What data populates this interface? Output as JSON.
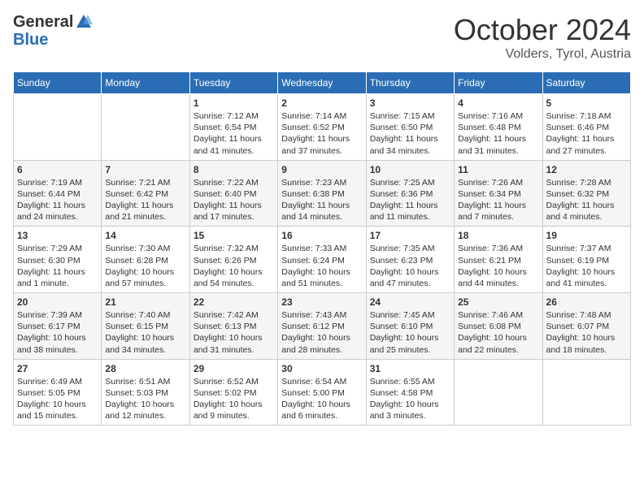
{
  "logo": {
    "general": "General",
    "blue": "Blue"
  },
  "header": {
    "month": "October 2024",
    "location": "Volders, Tyrol, Austria"
  },
  "weekdays": [
    "Sunday",
    "Monday",
    "Tuesday",
    "Wednesday",
    "Thursday",
    "Friday",
    "Saturday"
  ],
  "weeks": [
    [
      {
        "day": "",
        "info": ""
      },
      {
        "day": "",
        "info": ""
      },
      {
        "day": "1",
        "info": "Sunrise: 7:12 AM\nSunset: 6:54 PM\nDaylight: 11 hours and 41 minutes."
      },
      {
        "day": "2",
        "info": "Sunrise: 7:14 AM\nSunset: 6:52 PM\nDaylight: 11 hours and 37 minutes."
      },
      {
        "day": "3",
        "info": "Sunrise: 7:15 AM\nSunset: 6:50 PM\nDaylight: 11 hours and 34 minutes."
      },
      {
        "day": "4",
        "info": "Sunrise: 7:16 AM\nSunset: 6:48 PM\nDaylight: 11 hours and 31 minutes."
      },
      {
        "day": "5",
        "info": "Sunrise: 7:18 AM\nSunset: 6:46 PM\nDaylight: 11 hours and 27 minutes."
      }
    ],
    [
      {
        "day": "6",
        "info": "Sunrise: 7:19 AM\nSunset: 6:44 PM\nDaylight: 11 hours and 24 minutes."
      },
      {
        "day": "7",
        "info": "Sunrise: 7:21 AM\nSunset: 6:42 PM\nDaylight: 11 hours and 21 minutes."
      },
      {
        "day": "8",
        "info": "Sunrise: 7:22 AM\nSunset: 6:40 PM\nDaylight: 11 hours and 17 minutes."
      },
      {
        "day": "9",
        "info": "Sunrise: 7:23 AM\nSunset: 6:38 PM\nDaylight: 11 hours and 14 minutes."
      },
      {
        "day": "10",
        "info": "Sunrise: 7:25 AM\nSunset: 6:36 PM\nDaylight: 11 hours and 11 minutes."
      },
      {
        "day": "11",
        "info": "Sunrise: 7:26 AM\nSunset: 6:34 PM\nDaylight: 11 hours and 7 minutes."
      },
      {
        "day": "12",
        "info": "Sunrise: 7:28 AM\nSunset: 6:32 PM\nDaylight: 11 hours and 4 minutes."
      }
    ],
    [
      {
        "day": "13",
        "info": "Sunrise: 7:29 AM\nSunset: 6:30 PM\nDaylight: 11 hours and 1 minute."
      },
      {
        "day": "14",
        "info": "Sunrise: 7:30 AM\nSunset: 6:28 PM\nDaylight: 10 hours and 57 minutes."
      },
      {
        "day": "15",
        "info": "Sunrise: 7:32 AM\nSunset: 6:26 PM\nDaylight: 10 hours and 54 minutes."
      },
      {
        "day": "16",
        "info": "Sunrise: 7:33 AM\nSunset: 6:24 PM\nDaylight: 10 hours and 51 minutes."
      },
      {
        "day": "17",
        "info": "Sunrise: 7:35 AM\nSunset: 6:23 PM\nDaylight: 10 hours and 47 minutes."
      },
      {
        "day": "18",
        "info": "Sunrise: 7:36 AM\nSunset: 6:21 PM\nDaylight: 10 hours and 44 minutes."
      },
      {
        "day": "19",
        "info": "Sunrise: 7:37 AM\nSunset: 6:19 PM\nDaylight: 10 hours and 41 minutes."
      }
    ],
    [
      {
        "day": "20",
        "info": "Sunrise: 7:39 AM\nSunset: 6:17 PM\nDaylight: 10 hours and 38 minutes."
      },
      {
        "day": "21",
        "info": "Sunrise: 7:40 AM\nSunset: 6:15 PM\nDaylight: 10 hours and 34 minutes."
      },
      {
        "day": "22",
        "info": "Sunrise: 7:42 AM\nSunset: 6:13 PM\nDaylight: 10 hours and 31 minutes."
      },
      {
        "day": "23",
        "info": "Sunrise: 7:43 AM\nSunset: 6:12 PM\nDaylight: 10 hours and 28 minutes."
      },
      {
        "day": "24",
        "info": "Sunrise: 7:45 AM\nSunset: 6:10 PM\nDaylight: 10 hours and 25 minutes."
      },
      {
        "day": "25",
        "info": "Sunrise: 7:46 AM\nSunset: 6:08 PM\nDaylight: 10 hours and 22 minutes."
      },
      {
        "day": "26",
        "info": "Sunrise: 7:48 AM\nSunset: 6:07 PM\nDaylight: 10 hours and 18 minutes."
      }
    ],
    [
      {
        "day": "27",
        "info": "Sunrise: 6:49 AM\nSunset: 5:05 PM\nDaylight: 10 hours and 15 minutes."
      },
      {
        "day": "28",
        "info": "Sunrise: 6:51 AM\nSunset: 5:03 PM\nDaylight: 10 hours and 12 minutes."
      },
      {
        "day": "29",
        "info": "Sunrise: 6:52 AM\nSunset: 5:02 PM\nDaylight: 10 hours and 9 minutes."
      },
      {
        "day": "30",
        "info": "Sunrise: 6:54 AM\nSunset: 5:00 PM\nDaylight: 10 hours and 6 minutes."
      },
      {
        "day": "31",
        "info": "Sunrise: 6:55 AM\nSunset: 4:58 PM\nDaylight: 10 hours and 3 minutes."
      },
      {
        "day": "",
        "info": ""
      },
      {
        "day": "",
        "info": ""
      }
    ]
  ]
}
